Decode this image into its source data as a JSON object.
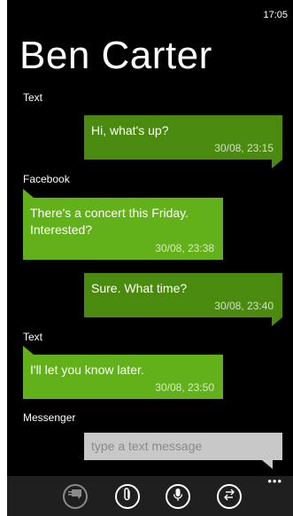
{
  "status": {
    "time": "17:05"
  },
  "contact": {
    "name": "Ben Carter"
  },
  "sections": {
    "text_1": "Text",
    "facebook": "Facebook",
    "text_2": "Text",
    "messenger": "Messenger"
  },
  "messages": [
    {
      "text": "Hi, what's up?",
      "time": "30/08, 23:15",
      "direction": "sent"
    },
    {
      "text": "There's a concert this Friday. Interested?",
      "text_line1": "There's a concert this Friday.",
      "text_line2": "Interested?",
      "time": "30/08, 23:38",
      "direction": "received"
    },
    {
      "text": "Sure. What time?",
      "time": "30/08, 23:40",
      "direction": "sent"
    },
    {
      "text": "I'll let you know later.",
      "time": "30/08, 23:50",
      "direction": "received"
    }
  ],
  "compose": {
    "placeholder": "type a text message"
  },
  "appbar": {
    "buttons": [
      {
        "name": "switch-conversation",
        "icon": "chat-switch-icon"
      },
      {
        "name": "attach",
        "icon": "paperclip-icon"
      },
      {
        "name": "voice",
        "icon": "microphone-icon"
      },
      {
        "name": "switch-service",
        "icon": "swap-arrows-icon"
      }
    ],
    "more": "•••"
  },
  "colors": {
    "sent_bubble": "#4a8a0e",
    "received_bubble": "#62b01a",
    "background": "#000000",
    "compose_bg": "#c8c8c8",
    "appbar_bg": "#1f1f1f"
  }
}
